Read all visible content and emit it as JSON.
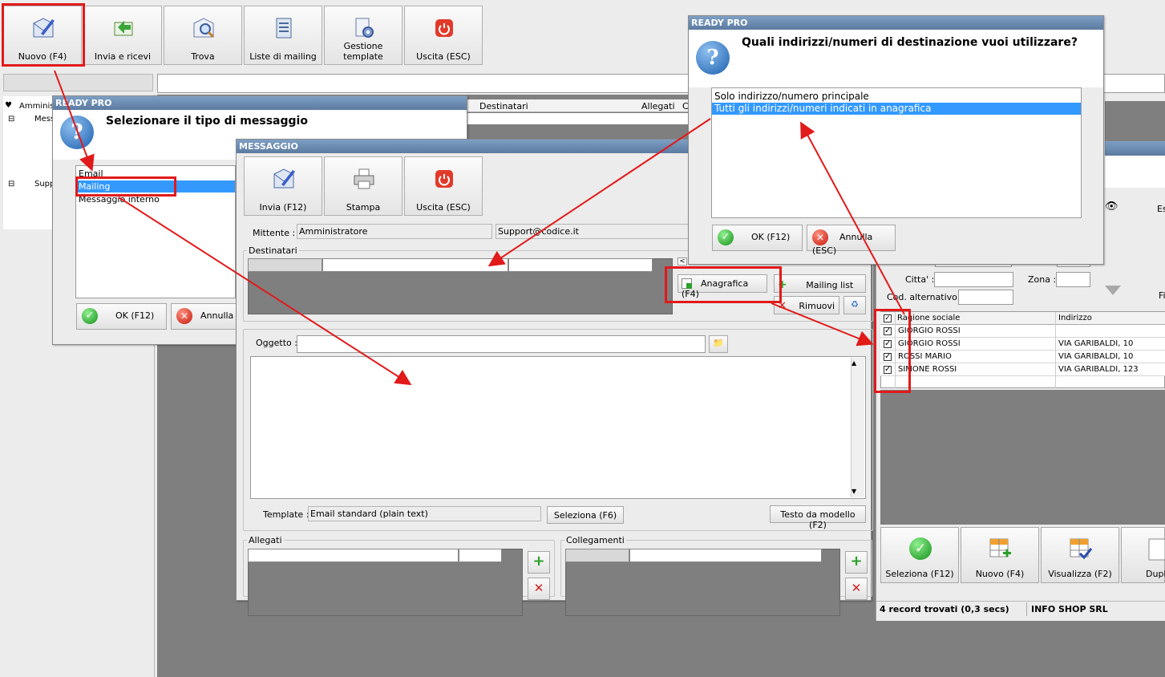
{
  "toolbar": {
    "new": "Nuovo (F4)",
    "send_receive": "Invia e ricevi",
    "find": "Trova",
    "mailing_lists": "Liste di mailing",
    "templates": "Gestione template",
    "exit": "Uscita (ESC)"
  },
  "tree": {
    "item1": "Amminist",
    "item2": "Mess",
    "item3": "Supp"
  },
  "main_grid": {
    "col_recipients": "Destinatari",
    "col_attachments": "Allegati",
    "col_c": "C"
  },
  "dialog_type": {
    "title": "READY PRO",
    "question": "Selezionare il tipo di messaggio",
    "options": [
      "Email",
      "Mailing",
      "Messaggio interno"
    ],
    "ok": "OK (F12)",
    "cancel": "Annulla ("
  },
  "dialog_msg": {
    "title": "MESSAGGIO",
    "send": "Invia (F12)",
    "print": "Stampa",
    "exit": "Uscita (ESC)",
    "sender_label": "Mittente :",
    "sender_name": "Amministratore",
    "sender_email": "Support@codice.it",
    "recipients_group": "Destinatari",
    "btn_registry": "Anagrafica (F4)",
    "btn_mailing": "Mailing list",
    "btn_remove": "Rimuovi",
    "subject_label": "Oggetto :",
    "template_label": "Template :",
    "template_value": "Email standard (plain text)",
    "btn_select": "Seleziona (F6)",
    "btn_text_model": "Testo da modello (F2)",
    "attachments_group": "Allegati",
    "links_group": "Collegamenti",
    "small_arrow": "<"
  },
  "dialog_addr": {
    "title": "READY PRO",
    "question": "Quali indirizzi/numeri di destinazione vuoi utilizzare?",
    "options": [
      "Solo indirizzo/numero principale",
      "Tutti gli indirizzi/numeri indicati in anagrafica"
    ],
    "ok": "OK (F12)",
    "cancel": "Annulla (ESC)"
  },
  "registry": {
    "city_label": "Citta' :",
    "zone_label": "Zona :",
    "alt_code_label": "Cod. alternativo :",
    "col_name": "Ragione sociale",
    "col_address": "Indirizzo",
    "rows": [
      {
        "name": "GIORGIO ROSSI",
        "address": ""
      },
      {
        "name": "GIORGIO ROSSI",
        "address": "VIA GARIBALDI, 10"
      },
      {
        "name": "ROSSI MARIO",
        "address": "VIA GARIBALDI, 10"
      },
      {
        "name": "SIMONE ROSSI",
        "address": "VIA GARIBALDI, 123"
      }
    ],
    "btn_select": "Seleziona (F12)",
    "btn_new": "Nuovo (F4)",
    "btn_view": "Visualizza (F2)",
    "btn_dup": "Dupli",
    "right_es": "Es",
    "right_fi": "Fi",
    "status": "4 record trovati (0,3 secs)",
    "company": "INFO SHOP SRL"
  }
}
